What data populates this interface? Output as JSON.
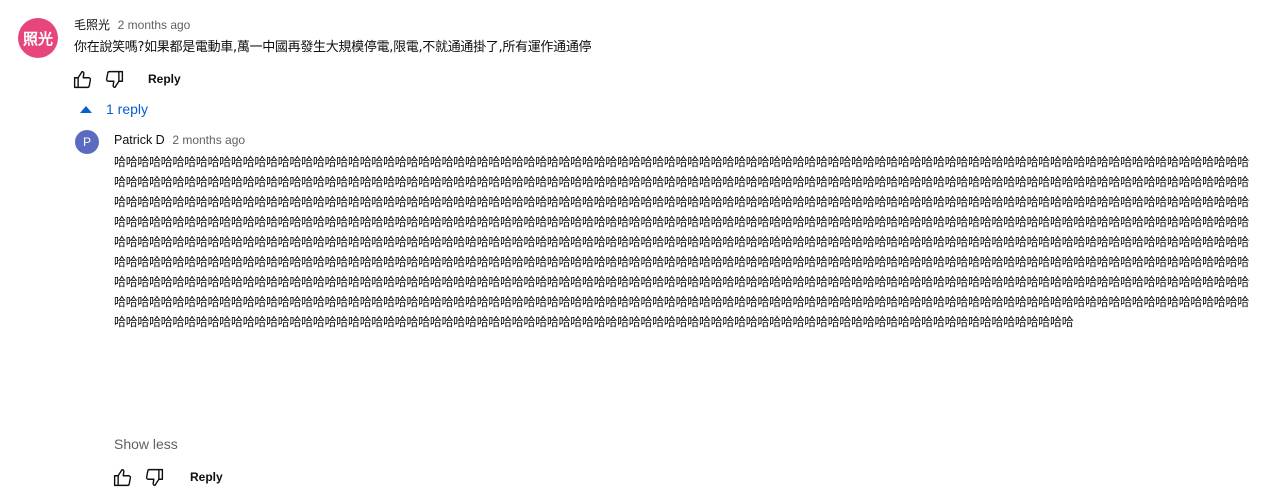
{
  "comment": {
    "avatar_text": "照光",
    "avatar_color": "#e7467d",
    "author": "毛照光",
    "time": "2 months ago",
    "text": "你在說笑嗎?如果都是電動車,萬一中國再發生大規模停電,限電,不就通通掛了,所有運作通通停",
    "reply_label": "Reply",
    "like_icon": "thumbs-up-icon",
    "dislike_icon": "thumbs-down-icon"
  },
  "replies_toggle": {
    "label": "1 reply",
    "color": "#065fd4"
  },
  "reply": {
    "avatar_text": "P",
    "avatar_color": "#5c6bc0",
    "author": "Patrick D",
    "time": "2 months ago",
    "text": "哈哈哈哈哈哈哈哈哈哈哈哈哈哈哈哈哈哈哈哈哈哈哈哈哈哈哈哈哈哈哈哈哈哈哈哈哈哈哈哈哈哈哈哈哈哈哈哈哈哈哈哈哈哈哈哈哈哈哈哈哈哈哈哈哈哈哈哈哈哈哈哈哈哈哈哈哈哈哈哈哈哈哈哈哈哈哈哈哈哈哈哈哈哈哈哈哈哈哈哈哈哈哈哈哈哈哈哈哈哈哈哈哈哈哈哈哈哈哈哈哈哈哈哈哈哈哈哈哈哈哈哈哈哈哈哈哈哈哈哈哈哈哈哈哈哈哈哈哈哈哈哈哈哈哈哈哈哈哈哈哈哈哈哈哈哈哈哈哈哈哈哈哈哈哈哈哈哈哈哈哈哈哈哈哈哈哈哈哈哈哈哈哈哈哈哈哈哈哈哈哈哈哈哈哈哈哈哈哈哈哈哈哈哈哈哈哈哈哈哈哈哈哈哈哈哈哈哈哈哈哈哈哈哈哈哈哈哈哈哈哈哈哈哈哈哈哈哈哈哈哈哈哈哈哈哈哈哈哈哈哈哈哈哈哈哈哈哈哈哈哈哈哈哈哈哈哈哈哈哈哈哈哈哈哈哈哈哈哈哈哈哈哈哈哈哈哈哈哈哈哈哈哈哈哈哈哈哈哈哈哈哈哈哈哈哈哈哈哈哈哈哈哈哈哈哈哈哈哈哈哈哈哈哈哈哈哈哈哈哈哈哈哈哈哈哈哈哈哈哈哈哈哈哈哈哈哈哈哈哈哈哈哈哈哈哈哈哈哈哈哈哈哈哈哈哈哈哈哈哈哈哈哈哈哈哈哈哈哈哈哈哈哈哈哈哈哈哈哈哈哈哈哈哈哈哈哈哈哈哈哈哈哈哈哈哈哈哈哈哈哈哈哈哈哈哈哈哈哈哈哈哈哈哈哈哈哈哈哈哈哈哈哈哈哈哈哈哈哈哈哈哈哈哈哈哈哈哈哈哈哈哈哈哈哈哈哈哈哈哈哈哈哈哈哈哈哈哈哈哈哈哈哈哈哈哈哈哈哈哈哈哈哈哈哈哈哈哈哈哈哈哈哈哈哈哈哈哈哈哈哈哈哈哈哈哈哈哈哈哈哈哈哈哈哈哈哈哈哈哈哈哈哈哈哈哈哈哈哈哈哈哈哈哈哈哈哈哈哈哈哈哈哈哈哈哈哈哈哈哈哈哈哈哈哈哈哈哈哈哈哈哈哈哈哈哈哈哈哈哈哈哈哈哈哈哈哈哈哈哈哈哈哈哈哈哈哈哈哈哈哈哈哈哈哈哈哈哈哈哈哈哈哈哈哈哈哈哈哈哈哈哈哈哈哈哈哈哈哈哈哈哈哈哈哈哈哈哈哈哈哈哈哈哈哈哈哈哈哈哈哈哈哈哈哈哈哈哈哈哈哈哈哈哈哈哈哈哈哈哈哈哈哈哈哈哈哈哈哈哈哈哈哈哈哈哈哈哈哈哈哈哈哈哈哈哈哈哈哈哈哈哈哈哈哈哈哈哈哈哈哈哈哈哈哈哈哈哈哈哈哈哈哈哈哈哈哈哈哈哈哈哈哈哈哈哈哈哈哈哈哈哈哈哈哈哈哈哈哈哈哈哈哈哈哈哈哈哈哈哈哈哈哈哈哈哈哈哈哈哈哈哈哈哈哈哈哈哈哈哈哈哈哈哈哈哈哈哈哈哈哈哈哈哈哈哈哈哈哈哈哈哈哈哈哈哈哈哈哈哈哈哈哈哈哈哈哈哈哈哈哈哈哈哈哈哈哈哈哈哈哈哈哈哈哈哈哈哈哈哈哈哈哈哈哈哈哈哈哈哈哈哈哈哈哈哈哈哈",
    "show_less_label": "Show less",
    "reply_label": "Reply",
    "like_icon": "thumbs-up-icon",
    "dislike_icon": "thumbs-down-icon"
  }
}
